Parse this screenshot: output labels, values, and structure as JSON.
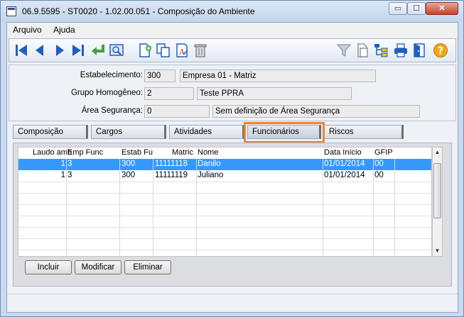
{
  "window": {
    "title": "06.9.5595 - ST0020 - 1.02.00.051 - Composição do Ambiente",
    "min_glyph": "▭",
    "max_glyph": "☐",
    "close_glyph": "✕"
  },
  "menu": {
    "items": [
      "Arquivo",
      "Ajuda"
    ]
  },
  "toolbar": {
    "icons": [
      "first-record-icon",
      "previous-record-icon",
      "next-record-icon",
      "last-record-icon",
      "return-icon",
      "zoom-icon",
      "new-document-icon",
      "copy-icon",
      "edit-text-icon",
      "delete-icon",
      "filter-icon",
      "document-icon",
      "hierarchy-icon",
      "print-icon",
      "exit-door-icon",
      "help-icon"
    ],
    "help_glyph": "?"
  },
  "form": {
    "estabelecimento_label": "Estabelecimento:",
    "estabelecimento_code": "300",
    "estabelecimento_name": "Empresa 01 - Matriz",
    "grupo_label": "Grupo Homogêneo:",
    "grupo_code": "2",
    "grupo_name": "Teste PPRA",
    "area_label": "Área Segurança:",
    "area_code": "0",
    "area_name": "Sem definição de Área Segurança"
  },
  "tabs": [
    "Composição",
    "Cargos",
    "Atividades",
    "Funcionários",
    "Riscos"
  ],
  "active_tab": "Funcionários",
  "table": {
    "columns": [
      "Laudo amb",
      "Emp Func",
      "Estab Fu",
      "Matric",
      "Nome",
      "Data Início",
      "GFIP"
    ],
    "rows": [
      [
        "1",
        "3",
        "300",
        "11111118",
        "Danilo",
        "01/01/2014",
        "00"
      ],
      [
        "1",
        "3",
        "300",
        "11111119",
        "Juliano",
        "01/01/2014",
        "00"
      ]
    ]
  },
  "buttons": {
    "incluir": "Incluir",
    "modificar": "Modificar",
    "eliminar": "Eliminar"
  },
  "colors": {
    "selection": "#3399ff",
    "highlight": "#f0852d",
    "toolbar_blue": "#1f5fbf"
  }
}
